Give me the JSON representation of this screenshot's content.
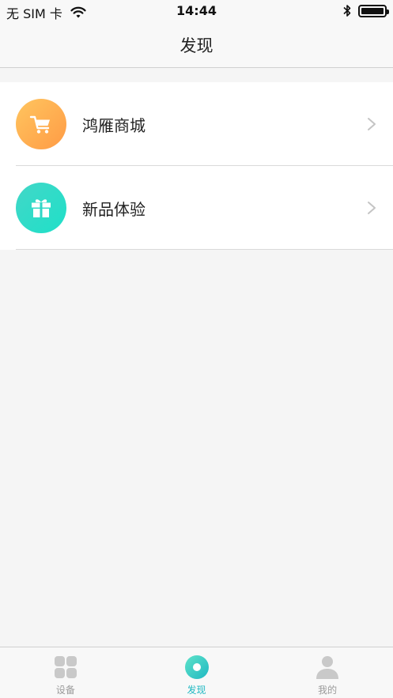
{
  "status_bar": {
    "carrier": "无 SIM 卡",
    "time": "14:44"
  },
  "nav": {
    "title": "发现"
  },
  "list": {
    "items": [
      {
        "label": "鸿雁商城",
        "icon": "cart-icon"
      },
      {
        "label": "新品体验",
        "icon": "gift-icon"
      }
    ]
  },
  "tabs": [
    {
      "label": "设备",
      "icon": "grid-icon",
      "active": false
    },
    {
      "label": "发现",
      "icon": "discover-icon",
      "active": true
    },
    {
      "label": "我的",
      "icon": "person-icon",
      "active": false
    }
  ],
  "colors": {
    "accent": "#1fb8c2",
    "orange_start": "#ffc55f",
    "orange_end": "#ff9b45",
    "teal_start": "#42d7c7",
    "teal_end": "#1fe0c9",
    "inactive_tab": "#9a9a9a"
  }
}
